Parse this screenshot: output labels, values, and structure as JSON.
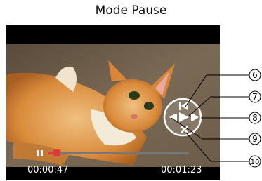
{
  "title": "Mode Pause",
  "player": {
    "current_time": "00:00:47",
    "total_time": "00:01:23",
    "progress_fraction": 0.06,
    "progress_color": "#e03a3a",
    "pause_icon": "pause-icon"
  },
  "controls": {
    "icons": [
      "skip-to-start-icon",
      "play-icon",
      "rewind-icon",
      "fast-forward-icon",
      "stop-icon"
    ]
  },
  "callouts": [
    "6",
    "7",
    "8",
    "9",
    "10"
  ]
}
